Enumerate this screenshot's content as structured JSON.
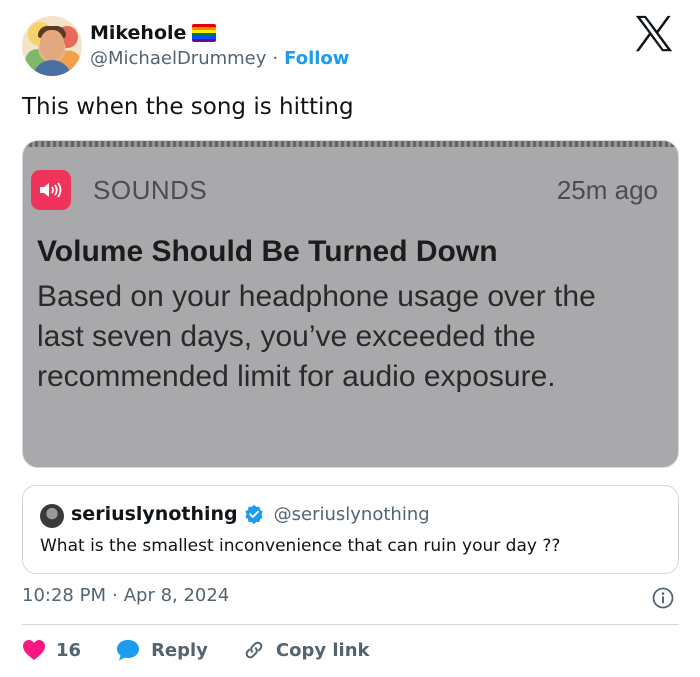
{
  "author": {
    "name": "Mikehole",
    "handle": "@MichaelDrummey",
    "separator": "·",
    "follow_label": "Follow"
  },
  "tweet": {
    "text": "This when the song is hitting"
  },
  "media": {
    "app_name": "SOUNDS",
    "time_ago": "25m ago",
    "title": "Volume Should Be Turned Down",
    "body": "Based on your headphone usage over the last seven days, you’ve exceeded the recommended limit for audio exposure.",
    "icon_color": "#f0335a"
  },
  "quote": {
    "name": "seriuslynothing",
    "handle": "@seriuslynothing",
    "text": "What is the smallest inconvenience that can ruin your day ??"
  },
  "meta": {
    "time": "10:28 PM",
    "separator": "·",
    "date": "Apr 8, 2024"
  },
  "actions": {
    "like_count": "16",
    "reply_label": "Reply",
    "copy_label": "Copy link"
  },
  "colors": {
    "accent": "#1d9bf0",
    "like": "#f91880",
    "text": "#0f1419",
    "muted": "#536471"
  },
  "icons": [
    "x-logo-icon",
    "pride-flag-icon",
    "sound-icon",
    "verified-badge-icon",
    "info-icon",
    "heart-icon",
    "reply-bubble-icon",
    "link-icon"
  ]
}
